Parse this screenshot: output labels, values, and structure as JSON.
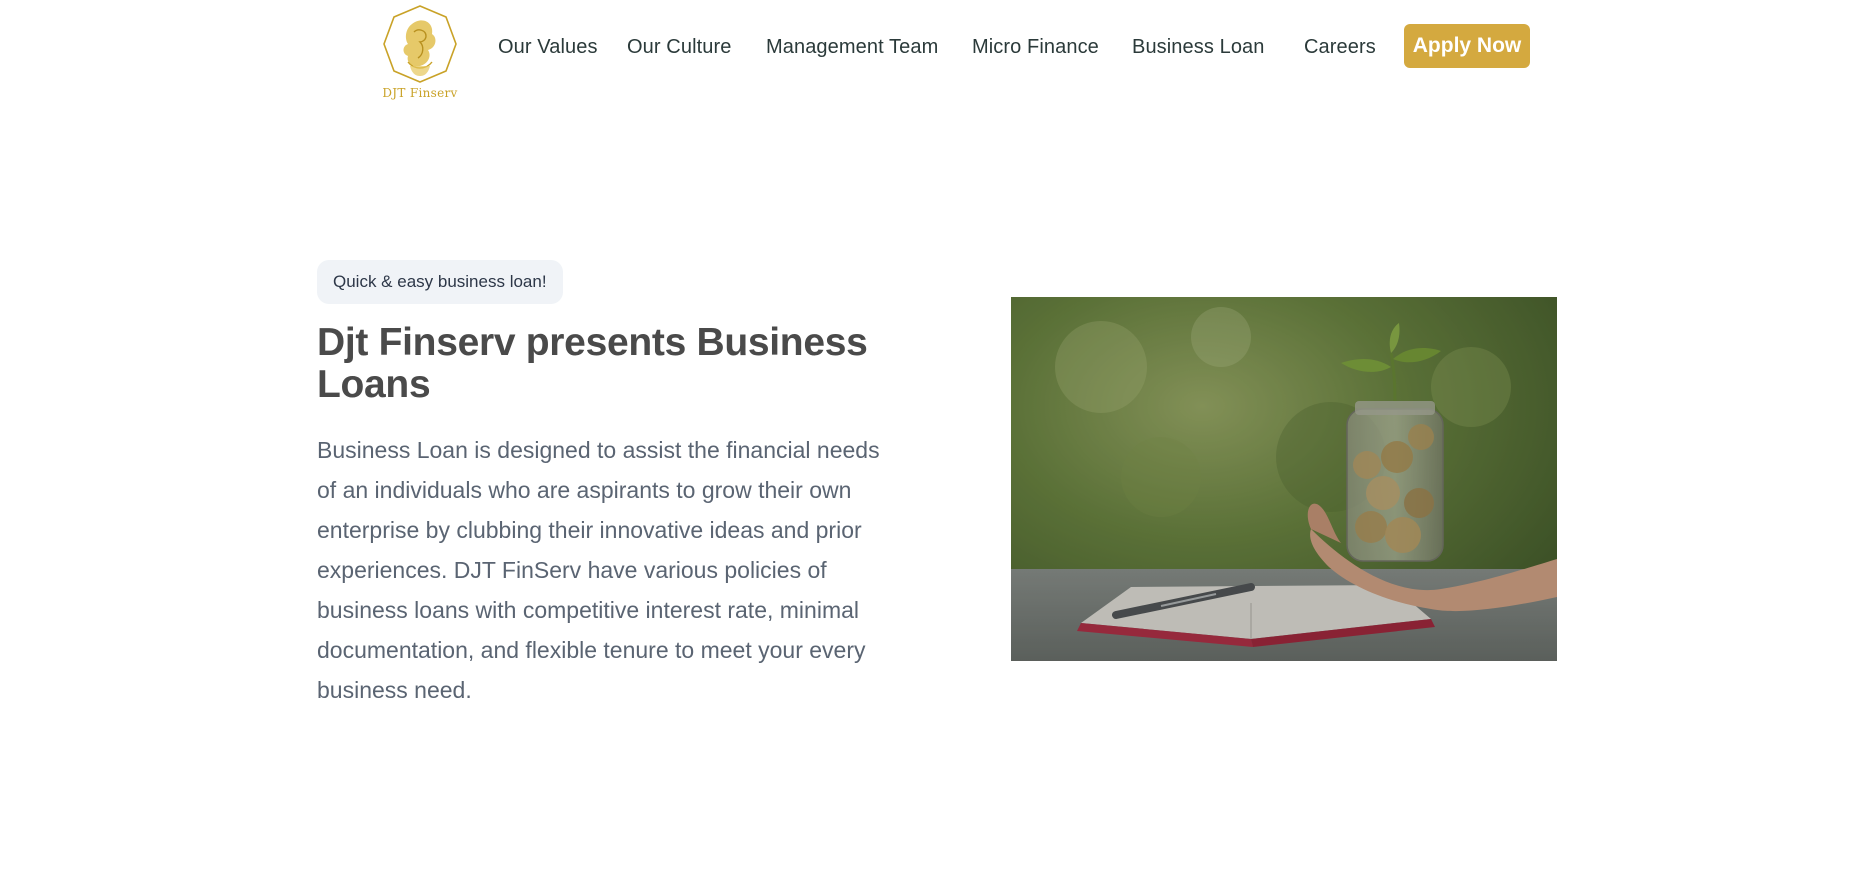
{
  "brand": {
    "name": "DJT Finserv",
    "logo_icon": "lion-octagon-logo-icon",
    "accent_color": "#d4a93f"
  },
  "nav": {
    "items": [
      {
        "label": "Our Values"
      },
      {
        "label": "Our Culture"
      },
      {
        "label": "Management Team"
      },
      {
        "label": "Micro Finance"
      },
      {
        "label": "Business Loan"
      },
      {
        "label": "Careers"
      }
    ],
    "cta_label": "Apply Now"
  },
  "hero": {
    "badge": "Quick & easy business loan!",
    "title": "Djt Finserv presents Business Loans",
    "description": "Business Loan is designed to assist the financial needs of an individuals who are aspirants to grow their own enterprise by clubbing their innovative ideas and prior experiences. DJT FinServ have various policies of business loans with competitive interest rate, minimal documentation, and flexible tenure to meet your every business need.",
    "image_subject": "hand holding jar of coins with sprouting plant over notebook and pen"
  }
}
